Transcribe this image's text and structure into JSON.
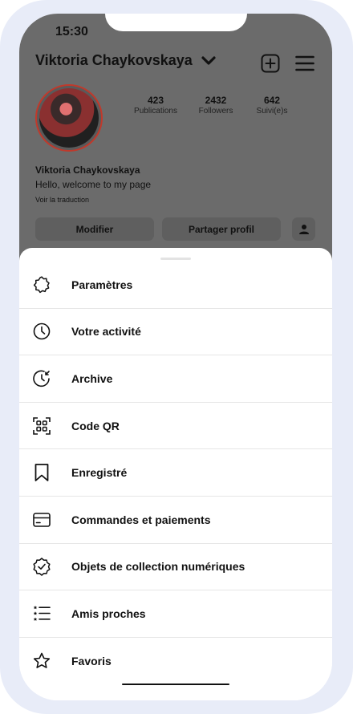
{
  "status_bar": {
    "time": "15:30"
  },
  "profile": {
    "username": "Viktoria Chaykovskaya",
    "stats": [
      {
        "value": "423",
        "label": "Publications"
      },
      {
        "value": "2432",
        "label": "Followers"
      },
      {
        "value": "642",
        "label": "Suivi(e)s"
      }
    ],
    "bio_name": "Viktoria Chaykovskaya",
    "bio_text": "Hello, welcome to my page",
    "translate_link": "Voir la traduction",
    "buttons": {
      "edit": "Modifier",
      "share": "Partager profil"
    }
  },
  "menu": {
    "items": [
      {
        "label": "Paramètres",
        "icon": "settings-icon"
      },
      {
        "label": "Votre activité",
        "icon": "activity-clock-icon"
      },
      {
        "label": "Archive",
        "icon": "archive-icon"
      },
      {
        "label": "Code QR",
        "icon": "qr-code-icon"
      },
      {
        "label": "Enregistré",
        "icon": "bookmark-icon"
      },
      {
        "label": "Commandes et paiements",
        "icon": "card-icon"
      },
      {
        "label": "Objets de collection numériques",
        "icon": "verified-badge-icon"
      },
      {
        "label": "Amis proches",
        "icon": "close-friends-list-icon"
      },
      {
        "label": "Favoris",
        "icon": "star-icon"
      }
    ]
  },
  "colors": {
    "overlay": "#6b6b6b",
    "frame": "#e8ecf8",
    "avatar_ring": "#c0392b"
  }
}
